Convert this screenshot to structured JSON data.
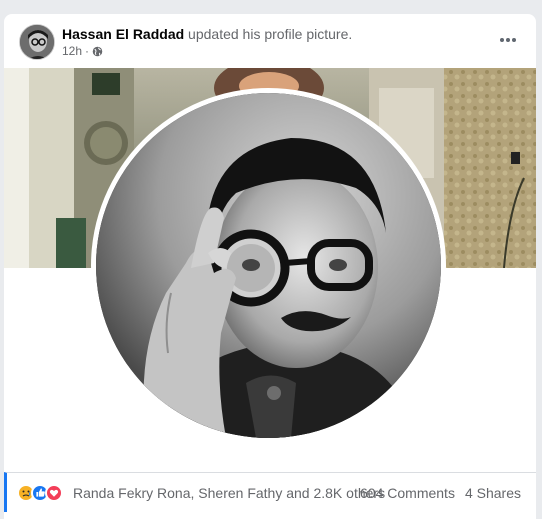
{
  "post": {
    "author": "Hassan El Raddad",
    "action": "updated his profile picture.",
    "time": "12h",
    "privacy_icon": "globe-icon",
    "more_icon": "more-options-icon"
  },
  "reactions": {
    "icons": [
      "sad-reaction-icon",
      "like-reaction-icon",
      "love-reaction-icon"
    ],
    "names": "Randa Fekry Rona, Sheren Fathy and 2.8K others",
    "comments": "604 Comments",
    "shares": "4 Shares"
  },
  "colors": {
    "accent": "#1877f2",
    "love": "#f33e58",
    "sad": "#f7b125"
  }
}
